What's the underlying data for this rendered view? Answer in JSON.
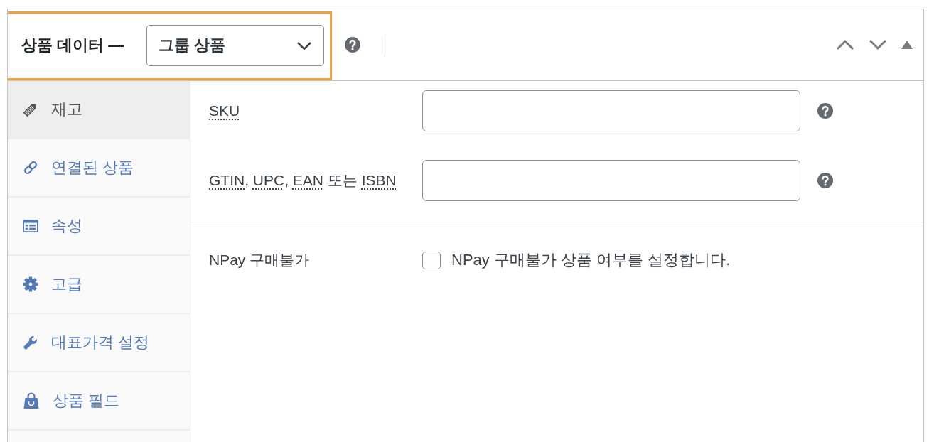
{
  "panel": {
    "title": "상품 데이터 —",
    "highlighted": true,
    "product_type": {
      "value": "그룹 상품"
    },
    "help": true
  },
  "sidebar": {
    "items": [
      {
        "label": "재고",
        "selected": true
      },
      {
        "label": "연결된 상품",
        "selected": false
      },
      {
        "label": "속성",
        "selected": false
      },
      {
        "label": "고급",
        "selected": false
      },
      {
        "label": "대표가격 설정",
        "selected": false
      },
      {
        "label": "상품 필드",
        "selected": false
      }
    ]
  },
  "groups": [
    {
      "fields": [
        {
          "kind": "text",
          "label_parts": [
            {
              "text": "SKU",
              "abbr": true
            }
          ],
          "help": true
        },
        {
          "kind": "text",
          "label_parts": [
            {
              "text": "GTIN",
              "abbr": true
            },
            {
              "text": ", ",
              "abbr": false
            },
            {
              "text": "UPC",
              "abbr": true
            },
            {
              "text": ", ",
              "abbr": false
            },
            {
              "text": "EAN",
              "abbr": true
            },
            {
              "text": " 또는 ",
              "abbr": false
            },
            {
              "text": "ISBN",
              "abbr": true
            }
          ],
          "help": true
        }
      ]
    },
    {
      "fields": [
        {
          "kind": "checkbox",
          "label_parts": [
            {
              "text": "NPay 구매불가",
              "abbr": false
            }
          ],
          "checked": false,
          "description": "NPay 구매불가 상품 여부를 설정합니다."
        }
      ]
    }
  ]
}
